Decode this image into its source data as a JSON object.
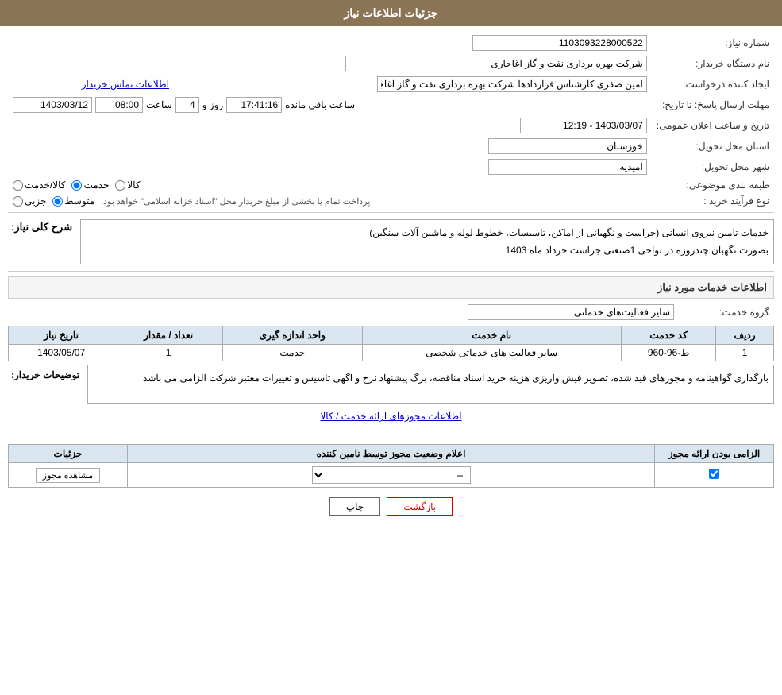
{
  "header": {
    "title": "جزئیات اطلاعات نیاز"
  },
  "fields": {
    "need_number_label": "شماره نیاز:",
    "need_number_value": "1103093228000522",
    "requester_org_label": "نام دستگاه خریدار:",
    "requester_org_value": "شرکت بهره برداری نفت و گاز اغاجاری",
    "creator_label": "ایجاد کننده درخواست:",
    "creator_value": "امین صفری کارشناس قراردادها شرکت بهره برداری نفت و گاز اغاجاری",
    "contact_link": "اطلاعات تماس خریدار",
    "deadline_label": "مهلت ارسال پاسخ: تا تاریخ:",
    "deadline_date": "1403/03/12",
    "deadline_time_label": "ساعت",
    "deadline_time": "08:00",
    "deadline_days_label": "روز و",
    "deadline_days": "4",
    "deadline_remaining_label": "ساعت باقی مانده",
    "deadline_remaining": "17:41:16",
    "announce_label": "تاریخ و ساعت اعلان عمومی:",
    "announce_value": "1403/03/07 - 12:19",
    "province_label": "استان محل تحویل:",
    "province_value": "خوزستان",
    "city_label": "شهر محل تحویل:",
    "city_value": "امیدیه",
    "category_label": "طبقه بندی موضوعی:",
    "category_options": [
      "کالا",
      "خدمت",
      "کالا/خدمت"
    ],
    "category_selected": "خدمت",
    "proc_type_label": "نوع فرآیند خرید :",
    "proc_type_options": [
      "جزیی",
      "متوسط"
    ],
    "proc_type_selected": "متوسط",
    "proc_type_note": "پرداخت تمام یا بخشی از مبلغ خریدار محل \"اسناد خزانه اسلامی\" خواهد بود."
  },
  "need_description": {
    "section_title": "شرح کلی نیاز:",
    "text_line1": "خدمات تامین نیروی انسانی (جراست و نگهبانی از اماکن، تاسیسات، خطوط لوله و ماشین آلات سنگین)",
    "text_line2": "بصورت نگهبان چندروزه در نواحی 1صنعتی جراست خرداد ماه 1403"
  },
  "service_info": {
    "section_title": "اطلاعات خدمات مورد نیاز",
    "service_group_label": "گروه خدمت:",
    "service_group_value": "سایر فعالیت‌های خدماتی"
  },
  "table": {
    "headers": [
      "ردیف",
      "کد خدمت",
      "نام خدمت",
      "واحد اندازه گیری",
      "تعداد / مقدار",
      "تاریخ نیاز"
    ],
    "rows": [
      {
        "row": "1",
        "code": "ط-96-960",
        "name": "سایر فعالیت های خدماتی شخصی",
        "unit": "خدمت",
        "quantity": "1",
        "date": "1403/05/07"
      }
    ]
  },
  "buyer_notes": {
    "section_title": "توضیحات خریدار:",
    "text": "بارگذاری گواهینامه و مجوزهای قید شده، تصویر فیش واریزی هزینه جرید اسناد مناقصه، برگ پیشنهاد نرخ و اگهی تاسیس و تغییرات معتبر شرکت الزامی می باشد"
  },
  "permit_section": {
    "link_text": "اطلاعات مجوزهای ارائه خدمت / کالا",
    "table_headers": [
      "الزامی بودن ارائه مجوز",
      "اعلام وضعیت مجوز توسط نامین کننده",
      "جزئیات"
    ],
    "rows": [
      {
        "required": "✓",
        "status": "--",
        "details_btn": "مشاهده مجوز"
      }
    ]
  },
  "buttons": {
    "print_label": "چاپ",
    "back_label": "بازگشت"
  }
}
